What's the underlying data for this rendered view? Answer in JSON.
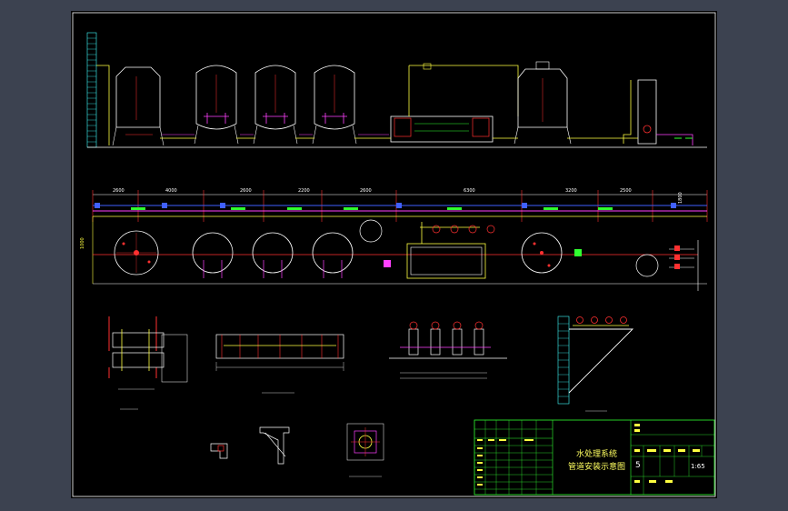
{
  "drawing": {
    "title_line1": "水处理系统",
    "title_line2": "管道安装示意图",
    "scale": "1:65",
    "sheet_no": "5"
  },
  "dimensions": {
    "top": [
      "2600",
      "4000",
      "2600",
      "2200",
      "2600",
      "6300",
      "3200",
      "2500"
    ],
    "right_vertical": "1800",
    "left_vertical": "1000"
  },
  "colors": {
    "background": "#000000",
    "frame": "#ffffff",
    "pipe_red": "#ff3030",
    "pipe_yellow": "#ffff40",
    "pipe_magenta": "#ff40ff",
    "pipe_green": "#30ff30",
    "pipe_blue": "#4060ff",
    "pipe_cyan": "#40ffff"
  }
}
